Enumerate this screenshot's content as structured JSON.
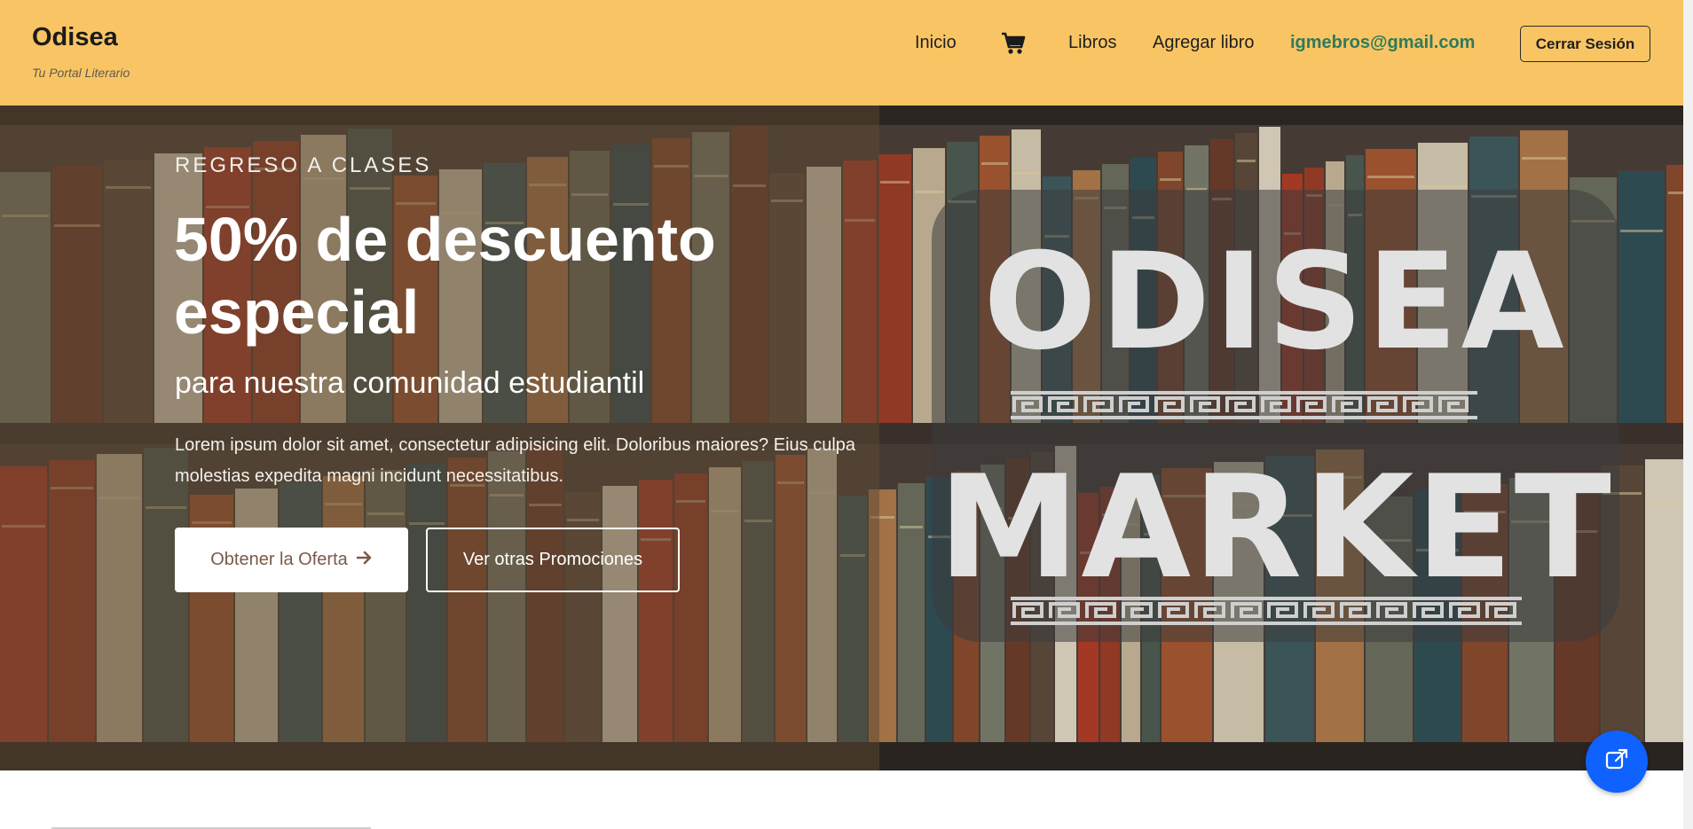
{
  "navbar": {
    "brand_title": "Odisea",
    "brand_subtitle": "Tu Portal Literario",
    "links": {
      "inicio": "Inicio",
      "cart_icon": "shopping-cart-icon",
      "libros": "Libros",
      "agregar": "Agregar libro",
      "email": "igmebros@gmail.com"
    },
    "logout_label": "Cerrar Sesión",
    "background_color": "#f9c564"
  },
  "hero": {
    "eyebrow": "REGRESO A CLASES",
    "headline": "50% de descuento especial",
    "subheadline": "para nuestra comunidad estudiantil",
    "lead": "Lorem ipsum dolor sit amet, consectetur adipisicing elit. Doloribus maiores? Eius culpa molestias expedita magni incidunt necessitatibus.",
    "primary_button": "Obtener la Oferta",
    "primary_button_icon": "arrow-right-icon",
    "secondary_button": "Ver otras Promociones",
    "logo_line1": "ODISEA",
    "logo_line2": "MARKET"
  },
  "fab": {
    "icon": "external-link-icon",
    "color": "#0f62fe"
  }
}
